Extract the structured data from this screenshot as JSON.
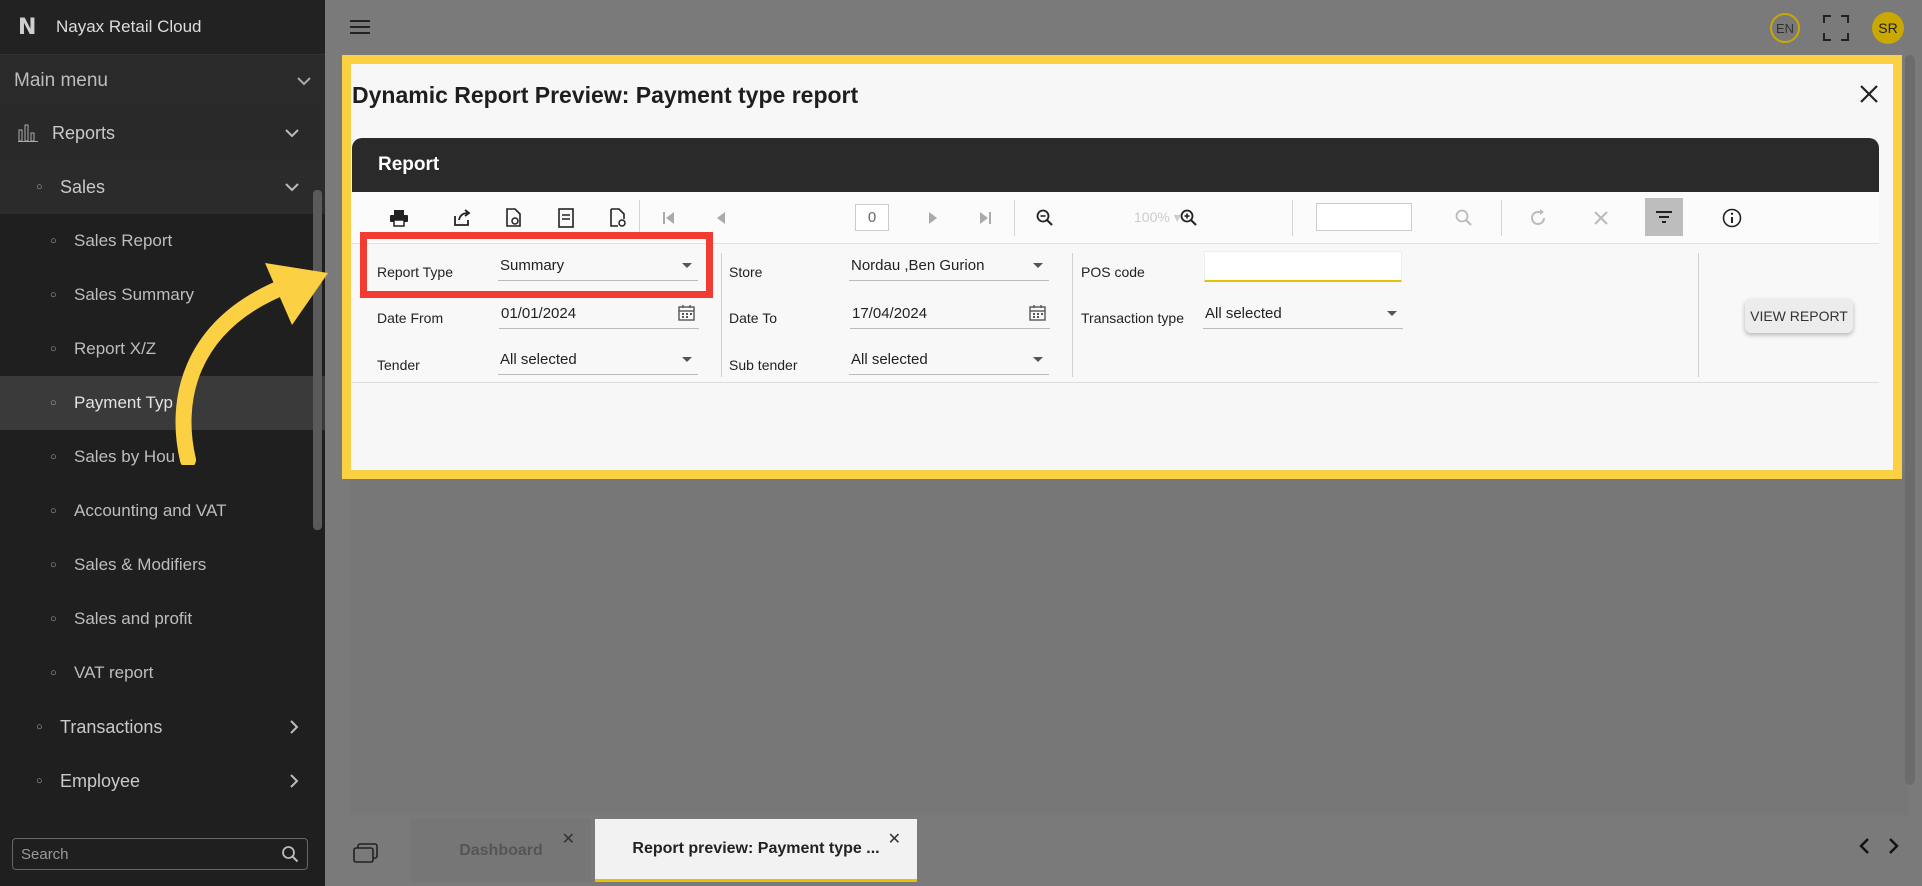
{
  "app": {
    "title": "Nayax Retail Cloud",
    "logo_letter": "N"
  },
  "sidebar": {
    "main_menu": "Main menu",
    "reports": "Reports",
    "sales": "Sales",
    "items": [
      "Sales Report",
      "Sales Summary",
      "Report X/Z",
      "Payment Typ",
      "Sales by Hou",
      "Accounting and VAT",
      "Sales & Modifiers",
      "Sales and profit",
      "VAT report"
    ],
    "transactions": "Transactions",
    "employee": "Employee",
    "search_placeholder": "Search"
  },
  "topbar": {
    "lang": "EN",
    "user_initials": "SR"
  },
  "modal": {
    "title": "Dynamic Report Preview: Payment type report",
    "report_header": "Report",
    "toolbar": {
      "page": "0",
      "zoom": "100%"
    },
    "params": {
      "report_type_label": "Report Type",
      "report_type_value": "Summary",
      "date_from_label": "Date From",
      "date_from_value": "01/01/2024",
      "tender_label": "Tender",
      "tender_value": "All selected",
      "store_label": "Store",
      "store_value": "Nordau ,Ben Gurion",
      "date_to_label": "Date To",
      "date_to_value": "17/04/2024",
      "sub_tender_label": "Sub tender",
      "sub_tender_value": "All selected",
      "pos_code_label": "POS code",
      "pos_code_value": "",
      "transaction_type_label": "Transaction type",
      "transaction_type_value": "All selected"
    },
    "view_report": "VIEW REPORT"
  },
  "tabs": [
    {
      "label": "Dashboard"
    },
    {
      "label": "Report preview: Payment type ..."
    }
  ],
  "colors": {
    "highlight": "#fbd042",
    "callout": "#f23c33",
    "accent": "#c9a800"
  }
}
